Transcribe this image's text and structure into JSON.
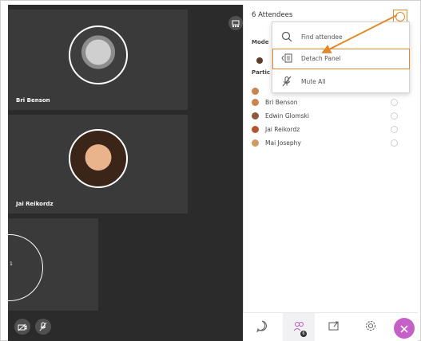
{
  "stage": {
    "tiles": [
      {
        "name": "Bri Benson"
      },
      {
        "name": "Jai Reikordz"
      },
      {
        "number": "1"
      }
    ]
  },
  "panel": {
    "title": "6 Attendees",
    "moderators_label": "Mode",
    "participants_label": "Partic",
    "participants": [
      {
        "name": "Bri Benson",
        "color": "#c98550"
      },
      {
        "name": "Edwin Glomski",
        "color": "#8a5a3a"
      },
      {
        "name": "Jai Reikordz",
        "color": "#b5552c"
      },
      {
        "name": "Mai Josephy",
        "color": "#d19a62"
      }
    ]
  },
  "menu": {
    "search_placeholder": "Find attendee",
    "detach_label": "Detach Panel",
    "mute_all_label": "Mute All"
  },
  "colors": {
    "highlight": "#e08a2c",
    "close_button": "#c660c9"
  },
  "toolbar": {
    "badge_count": "6"
  }
}
